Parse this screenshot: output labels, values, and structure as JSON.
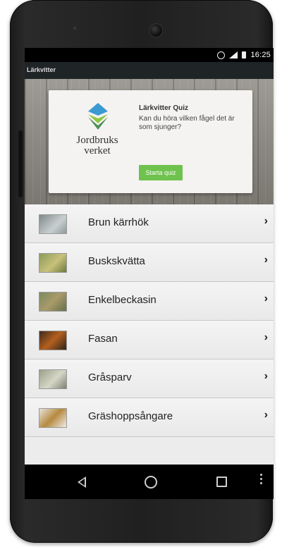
{
  "status_bar": {
    "time": "16:25"
  },
  "app_bar": {
    "title": "Lärkvitter"
  },
  "banner": {
    "logo_text": "Jordbruks\nverket",
    "quiz_title": "Lärkvitter Quiz",
    "quiz_description": "Kan du höra vilken fågel det är som sjunger?",
    "quiz_button": "Starta quiz"
  },
  "birds": [
    {
      "name": "Brun kärrhök"
    },
    {
      "name": "Buskskvätta"
    },
    {
      "name": "Enkelbeckasin"
    },
    {
      "name": "Fasan"
    },
    {
      "name": "Gråsparv"
    },
    {
      "name": "Gräshoppsångare"
    }
  ],
  "colors": {
    "accent_green": "#6fc24e",
    "appbar": "#1f2426",
    "list_background": "#ececec"
  }
}
